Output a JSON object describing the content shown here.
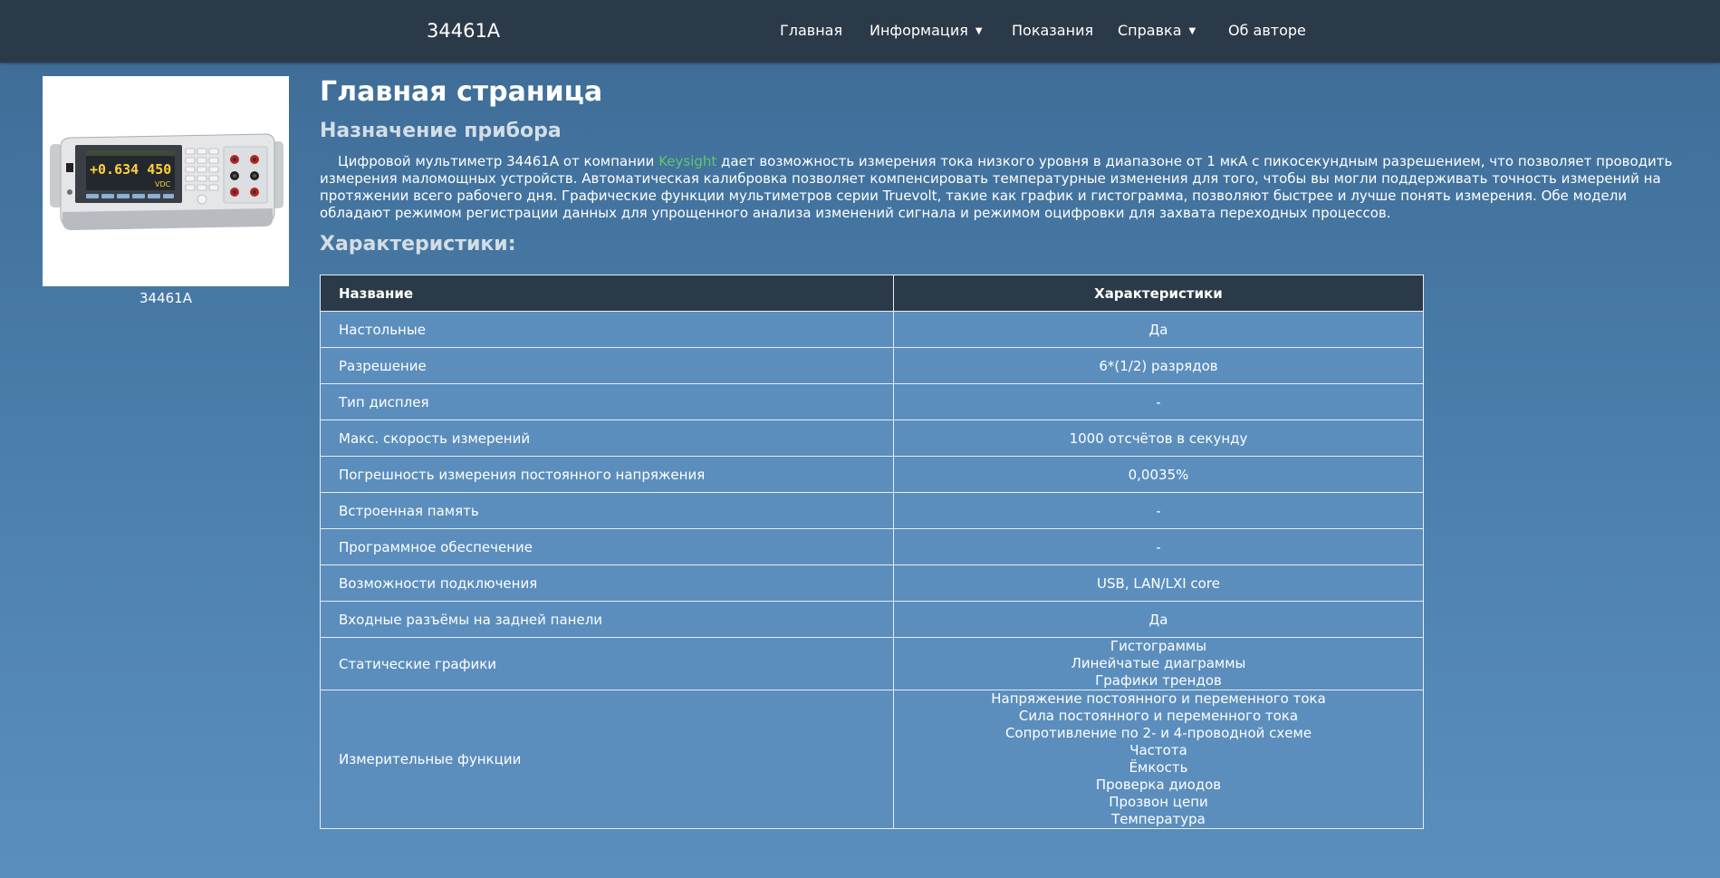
{
  "navbar": {
    "brand": "34461A",
    "items": [
      {
        "label": "Главная",
        "dropdown": false
      },
      {
        "label": "Информация",
        "dropdown": true
      },
      {
        "label": "Показания",
        "dropdown": false
      },
      {
        "label": "Справка",
        "dropdown": true
      },
      {
        "label": "Об авторе",
        "dropdown": false
      }
    ]
  },
  "product": {
    "image_caption": "34461A",
    "device_display_value": "+0.634 450",
    "device_display_unit": "VDC"
  },
  "main": {
    "title": "Главная страница",
    "purpose_heading": "Назначение прибора",
    "description_before_link": "Цифровой мультиметр 34461A от компании ",
    "description_link": "Keysight",
    "description_after_link": " дает возможность измерения тока низкого уровня в диапазоне от 1 мкА с пикосекундным разрешением, что позволяет проводить измерения маломощных устройств. Автоматическая калибровка позволяет компенсировать температурные изменения для того, чтобы вы могли поддерживать точность измерений на протяжении всего рабочего дня. Графические функции мультиметров серии Truevolt, такие как график и гистограмма, позволяют быстрее и лучше понять измерения. Обе модели обладают режимом регистрации данных для упрощенного анализа изменений сигнала и режимом оцифровки для захвата переходных процессов.",
    "specs_heading": "Характеристики:"
  },
  "table": {
    "headers": [
      "Название",
      "Характеристики"
    ],
    "rows": [
      {
        "name": "Настольные",
        "value": [
          "Да"
        ]
      },
      {
        "name": "Разрешение",
        "value": [
          "6*(1/2) разрядов"
        ]
      },
      {
        "name": "Тип дисплея",
        "value": [
          "-"
        ]
      },
      {
        "name": "Макс. скорость измерений",
        "value": [
          "1000 отсчётов в секунду"
        ]
      },
      {
        "name": "Погрешность измерения постоянного напряжения",
        "value": [
          "0,0035%"
        ]
      },
      {
        "name": "Встроенная память",
        "value": [
          "-"
        ]
      },
      {
        "name": "Программное обеспечение",
        "value": [
          "-"
        ]
      },
      {
        "name": "Возможности подключения",
        "value": [
          "USB, LAN/LXI core"
        ]
      },
      {
        "name": "Входные разъёмы на задней панели",
        "value": [
          "Да"
        ]
      },
      {
        "name": "Статические графики",
        "value": [
          "Гистограммы",
          "Линейчатые диаграммы",
          "Графики трендов"
        ]
      },
      {
        "name": "Измерительные функции",
        "value": [
          "Напряжение постоянного и переменного тока",
          "Сила постоянного и переменного тока",
          "Сопротивление по 2- и 4-проводной схеме",
          "Частота",
          "Ёмкость",
          "Проверка диодов",
          "Прозвон цепи",
          "Температура"
        ]
      }
    ]
  }
}
